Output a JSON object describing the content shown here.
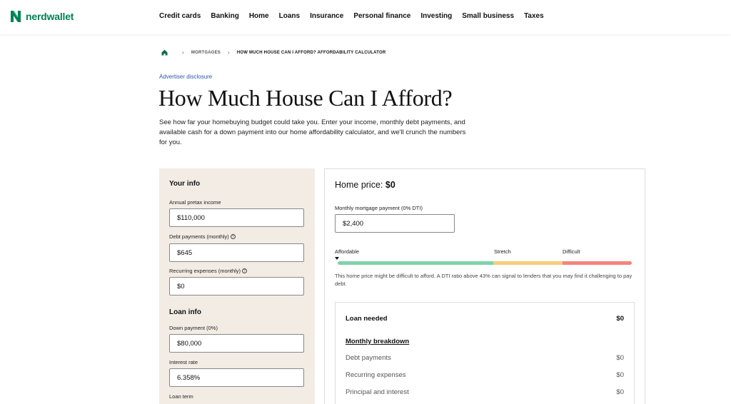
{
  "header": {
    "logo_text": "nerdwallet",
    "brand_color": "#008254",
    "nav": [
      "Credit cards",
      "Banking",
      "Home",
      "Loans",
      "Insurance",
      "Personal finance",
      "Investing",
      "Small business",
      "Taxes"
    ]
  },
  "breadcrumb": {
    "home_icon": "home-icon",
    "items": [
      "MORTGAGES",
      "HOW MUCH HOUSE CAN I AFFORD? AFFORDABILITY CALCULATOR"
    ]
  },
  "disclosure": "Advertiser disclosure",
  "page_title": "How Much House Can I Afford?",
  "intro": "See how far your homebuying budget could take you. Enter your income, monthly debt payments, and available cash for a down payment into our home affordability calculator, and we'll crunch the numbers for you.",
  "your_info": {
    "title": "Your info",
    "income_label": "Annual pretax income",
    "income_value": "$110,000",
    "debt_label": "Debt payments (monthly)",
    "debt_value": "$645",
    "recurring_label": "Recurring expenses (monthly)",
    "recurring_value": "$0"
  },
  "loan_info": {
    "title": "Loan info",
    "down_label": "Down payment (0%)",
    "down_value": "$80,000",
    "rate_label": "Interest rate",
    "rate_value": "6.358%",
    "term_label": "Loan term"
  },
  "result": {
    "home_price_label": "Home price:",
    "home_price_value": "$0",
    "mortgage_label": "Monthly mortgage payment (0% DTI)",
    "mortgage_value": "$2,400",
    "scale": {
      "affordable": "Affordable",
      "stretch": "Stretch",
      "difficult": "Difficult",
      "colors": {
        "affordable": "#7fd3a8",
        "stretch": "#f5cd7a",
        "difficult": "#f2857f"
      }
    },
    "dti_note": "This home price might be difficult to afford. A DTI ratio above 43% can signal to lenders that you may find it challenging to pay debt."
  },
  "breakdown": {
    "loan_needed_label": "Loan needed",
    "loan_needed_value": "$0",
    "monthly_title": "Monthly breakdown",
    "rows": [
      {
        "label": "Debt payments",
        "value": "$0"
      },
      {
        "label": "Recurring expenses",
        "value": "$0"
      },
      {
        "label": "Principal and interest",
        "value": "$0"
      }
    ]
  }
}
